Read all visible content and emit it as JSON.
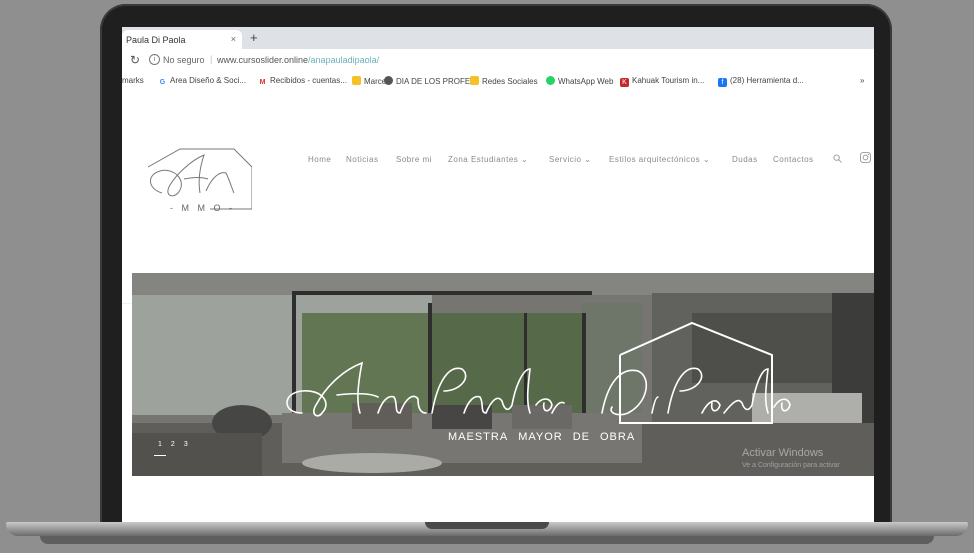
{
  "browser": {
    "tab_title": "Paula Di Paola",
    "tab_close": "×",
    "new_tab": "+",
    "reload_icon": "↻",
    "security_text": "No seguro",
    "url_domain": "www.cursoslider.online",
    "url_path": "/anapauladipaola/",
    "bookmarks": [
      {
        "label": "marks",
        "icon": ""
      },
      {
        "label": "Area Diseño & Soci...",
        "icon": "G",
        "color": "#4285f4"
      },
      {
        "label": "Recibidos - cuentas...",
        "icon": "M",
        "color": "#d93025"
      },
      {
        "label": "Marce",
        "icon": "▮",
        "color": "#f6c026"
      },
      {
        "label": "DIA DE LOS PROFE...",
        "icon": "◉",
        "color": "#555555"
      },
      {
        "label": "Redes Sociales",
        "icon": "▮",
        "color": "#f6c026"
      },
      {
        "label": "WhatsApp Web",
        "icon": "◉",
        "color": "#25d366"
      },
      {
        "label": "Kahuak Tourism in...",
        "icon": "K",
        "color": "#c62828"
      },
      {
        "label": "(28) Herramienta d...",
        "icon": "f",
        "color": "#1877f2"
      },
      {
        "label": "»",
        "icon": ""
      }
    ]
  },
  "site": {
    "logo_letters": "- M M O -",
    "nav": [
      "Home",
      "Noticias",
      "Sobre mi",
      "Zona Estudiantes ⌄",
      "Servicio ⌄",
      "Estilos arquitectónicos ⌄",
      "Dudas",
      "Contactos"
    ]
  },
  "hero": {
    "script_title": "Ana Paula Di Paola",
    "subtitle_words": [
      "MAESTRA",
      "MAYOR",
      "DE",
      "OBRA"
    ],
    "pager": [
      "1",
      "2",
      "3"
    ],
    "windows_activate": "Activar Windows",
    "windows_activate_sub": "Ve a Configuración para activar"
  },
  "colors": {
    "accent_link": "#6bb0b8",
    "nav_text": "#8a8a8a",
    "laptop_frame": "#1f1f1f",
    "background": "#8f8f8f"
  }
}
